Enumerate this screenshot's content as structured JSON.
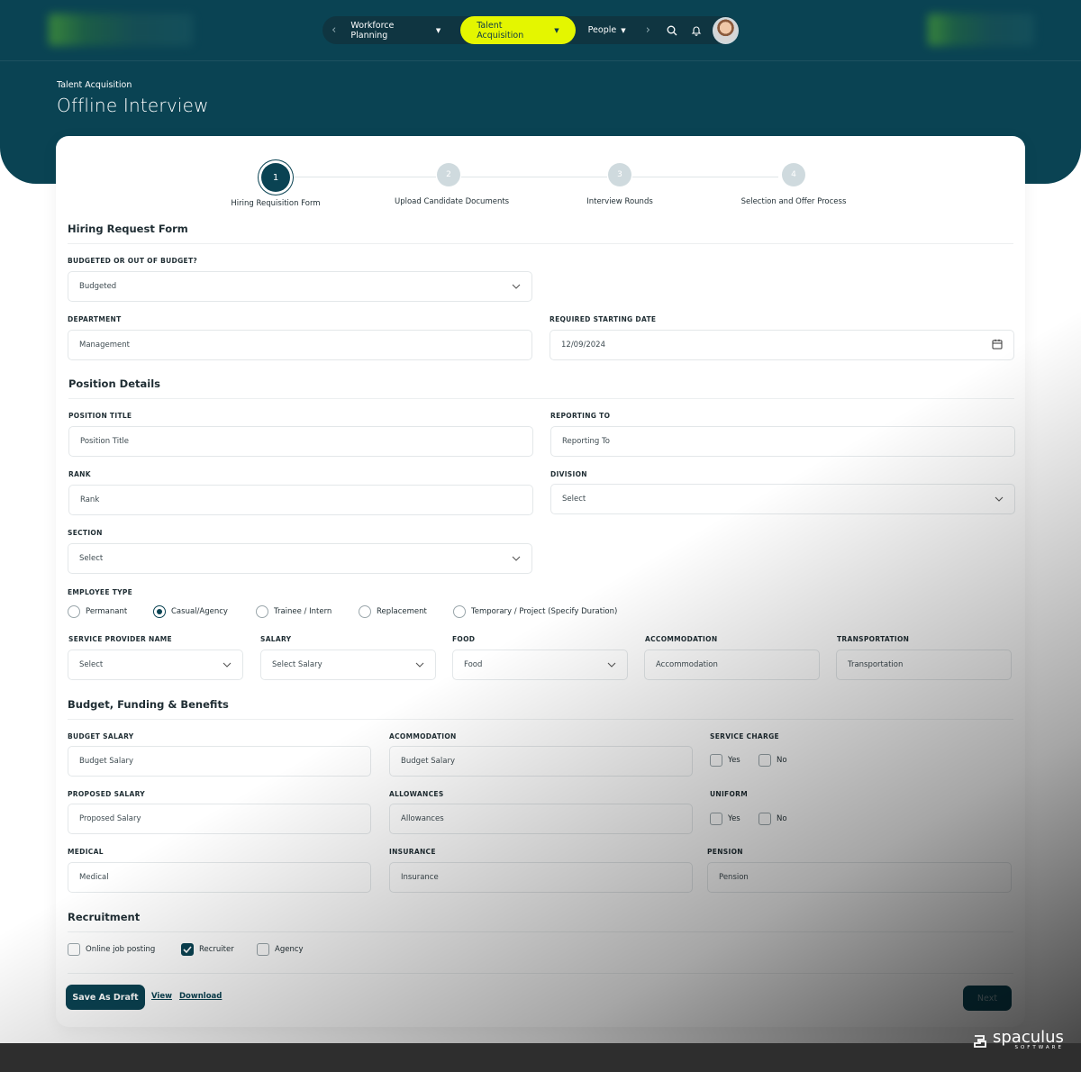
{
  "nav": {
    "items": [
      {
        "label": "Workforce Planning",
        "active": false
      },
      {
        "label": "Talent Acquisition",
        "active": true
      },
      {
        "label": "People",
        "active": false
      }
    ]
  },
  "header": {
    "breadcrumb": "Talent Acquisition",
    "title": "Offline Interview"
  },
  "steps": [
    {
      "number": "1",
      "label": "Hiring Requisition Form"
    },
    {
      "number": "2",
      "label": "Upload Candidate Documents"
    },
    {
      "number": "3",
      "label": "Interview Rounds"
    },
    {
      "number": "4",
      "label": "Selection and Offer Process"
    }
  ],
  "form": {
    "hiring_title": "Hiring Request Form",
    "budgeted_label": "BUDGETED OR OUT OF BUDGET?",
    "budgeted_value": "Budgeted",
    "department_label": "DEPARTMENT",
    "department_value": "Management",
    "start_date_label": "REQUIRED STARTING DATE",
    "start_date_value": "12/09/2024",
    "position_title": "Position Details",
    "position_label": "POSITION TITLE",
    "position_placeholder": "Position Title",
    "reporting_label": "REPORTING TO",
    "reporting_placeholder": "Reporting To",
    "rank_label": "RANK",
    "rank_placeholder": "Rank",
    "division_label": "DIVISION",
    "division_value": "Select",
    "section_label": "SECTION",
    "section_value": "Select",
    "employee_type_label": "EMPLOYEE TYPE",
    "employee_types": [
      {
        "label": "Permanant",
        "selected": false
      },
      {
        "label": "Casual/Agency",
        "selected": true
      },
      {
        "label": "Trainee / Intern",
        "selected": false
      },
      {
        "label": "Replacement",
        "selected": false
      },
      {
        "label": "Temporary / Project (Specify Duration)",
        "selected": false
      }
    ],
    "service_provider_label": "SERVICE PROVIDER NAME",
    "service_provider_value": "Select",
    "salary_label": "SALARY",
    "salary_value": "Select Salary",
    "food_label": "FOOD",
    "food_value": "Food",
    "accommodation_label": "ACCOMMODATION",
    "accommodation_placeholder": "Accommodation",
    "transportation_label": "TRANSPORTATION",
    "transportation_placeholder": "Transportation",
    "budget_title": "Budget, Funding & Benefits",
    "budget_salary_label": "BUDGET SALARY",
    "budget_salary_placeholder": "Budget Salary",
    "acommodation_label": "ACOMMODATION",
    "acommodation_placeholder": "Budget Salary",
    "service_charge_label": "SERVICE CHARGE",
    "proposed_salary_label": "PROPOSED SALARY",
    "proposed_salary_placeholder": "Proposed Salary",
    "allowances_label": "ALLOWANCES",
    "allowances_placeholder": "Allowances",
    "uniform_label": "UNIFORM",
    "medical_label": "MEDICAL",
    "medical_placeholder": "Medical",
    "insurance_label": "INSURANCE",
    "insurance_placeholder": "Insurance",
    "pension_label": "PENSION",
    "pension_placeholder": "Pension",
    "yes_label": "Yes",
    "no_label": "No",
    "recruitment_title": "Recruitment",
    "recruitment_options": [
      {
        "label": "Online job posting",
        "checked": false
      },
      {
        "label": "Recruiter",
        "checked": true
      },
      {
        "label": "Agency",
        "checked": false
      }
    ]
  },
  "actions": {
    "save_draft": "Save As Draft",
    "view": "View",
    "download": "Download",
    "next": "Next"
  },
  "brand": {
    "name": "spaculus",
    "tagline": "SOFTWARE"
  },
  "colors": {
    "primary": "#0a4353",
    "accent": "#e4f600"
  }
}
